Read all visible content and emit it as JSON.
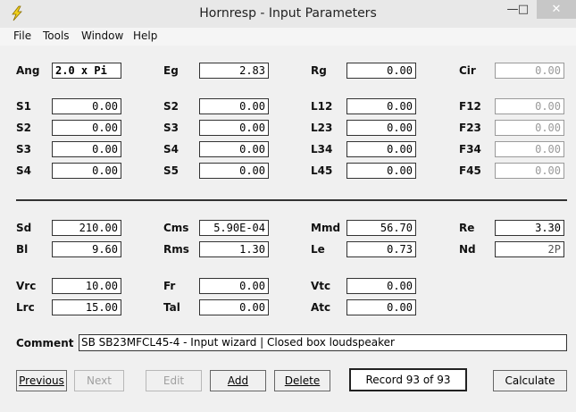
{
  "window": {
    "title": "Hornresp - Input Parameters",
    "minimize": "—",
    "maximize": "□",
    "close": "✕"
  },
  "menu": [
    "File",
    "Tools",
    "Window",
    "Help"
  ],
  "params": {
    "Ang": "2.0 x Pi",
    "Eg": "2.83",
    "Rg": "0.00",
    "Cir": "0.00",
    "S1": "0.00",
    "S2a": "0.00",
    "L12": "0.00",
    "F12": "0.00",
    "S2": "0.00",
    "S3a": "0.00",
    "L23": "0.00",
    "F23": "0.00",
    "S3": "0.00",
    "S4a": "0.00",
    "L34": "0.00",
    "F34": "0.00",
    "S4": "0.00",
    "S5": "0.00",
    "L45": "0.00",
    "F45": "0.00",
    "Sd": "210.00",
    "Cms": "5.90E-04",
    "Mmd": "56.70",
    "Re": "3.30",
    "Bl": "9.60",
    "Rms": "1.30",
    "Le": "0.73",
    "Nd": "2P",
    "Vrc": "10.00",
    "Fr": "0.00",
    "Vtc": "0.00",
    "Lrc": "15.00",
    "Tal": "0.00",
    "Atc": "0.00"
  },
  "labels": {
    "Ang": "Ang",
    "Eg": "Eg",
    "Rg": "Rg",
    "Cir": "Cir",
    "S1": "S1",
    "S2": "S2",
    "S3": "S3",
    "S4": "S4",
    "S5": "S5",
    "L12": "L12",
    "L23": "L23",
    "L34": "L34",
    "L45": "L45",
    "F12": "F12",
    "F23": "F23",
    "F34": "F34",
    "F45": "F45",
    "Sd": "Sd",
    "Cms": "Cms",
    "Mmd": "Mmd",
    "Re": "Re",
    "Bl": "Bl",
    "Rms": "Rms",
    "Le": "Le",
    "Nd": "Nd",
    "Vrc": "Vrc",
    "Fr": "Fr",
    "Vtc": "Vtc",
    "Lrc": "Lrc",
    "Tal": "Tal",
    "Atc": "Atc"
  },
  "comment": {
    "label": "Comment",
    "value": "SB SB23MFCL45-4 - Input wizard | Closed box loudspeaker"
  },
  "buttons": {
    "previous": "Previous",
    "next": "Next",
    "edit": "Edit",
    "add": "Add",
    "delete": "Delete",
    "calculate": "Calculate"
  },
  "record": "Record 93 of 93"
}
